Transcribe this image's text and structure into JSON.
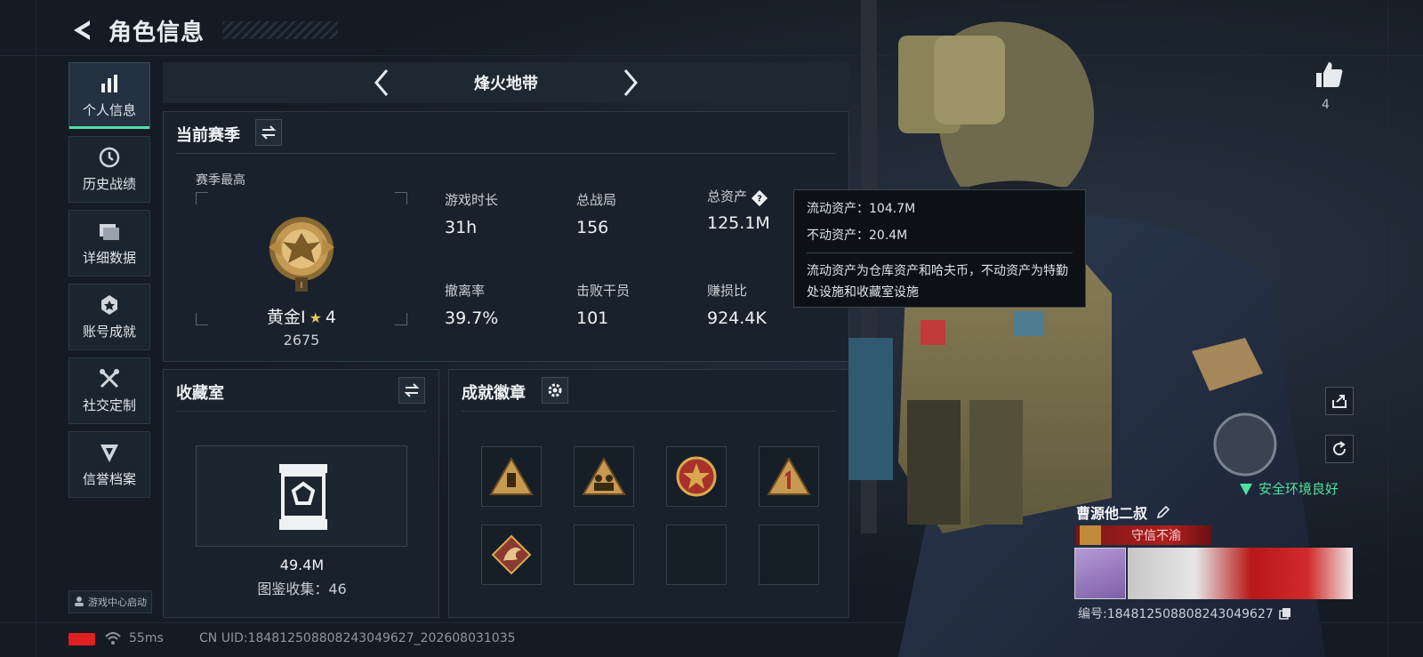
{
  "header": {
    "title": "角色信息"
  },
  "sidebar": {
    "items": [
      {
        "label": "个人信息",
        "icon": "bar-chart-icon",
        "active": true
      },
      {
        "label": "历史战绩",
        "icon": "clock-icon",
        "active": false
      },
      {
        "label": "详细数据",
        "icon": "folder-icon",
        "active": false
      },
      {
        "label": "账号成就",
        "icon": "medal-icon",
        "active": false
      },
      {
        "label": "社交定制",
        "icon": "tools-icon",
        "active": false
      },
      {
        "label": "信誉档案",
        "icon": "shield-icon",
        "active": false
      }
    ],
    "launch_label": "游戏中心启动"
  },
  "mode": {
    "name": "烽火地带"
  },
  "season": {
    "title": "当前赛季",
    "subtitle": "赛季最高",
    "rank_name": "黄金I",
    "rank_stars": "4",
    "rank_score": "2675",
    "stats": [
      {
        "label": "游戏时长",
        "value": "31h"
      },
      {
        "label": "总战局",
        "value": "156"
      },
      {
        "label": "总资产",
        "value": "125.1M"
      },
      {
        "label": "撤离率",
        "value": "39.7%"
      },
      {
        "label": "击败干员",
        "value": "101"
      },
      {
        "label": "赚损比",
        "value": "924.4K"
      }
    ]
  },
  "tooltip": {
    "liquid": "流动资产：104.7M",
    "fixed": "不动资产：20.4M",
    "desc": "流动资产为仓库资产和哈夫币，不动资产为特勤处设施和收藏室设施"
  },
  "collection": {
    "title": "收藏室",
    "value": "49.4M",
    "count_label": "图鉴收集：46"
  },
  "badges": {
    "title": "成就徽章",
    "filled": 5,
    "total": 8
  },
  "status": {
    "ping": "55ms",
    "uid": "CN UID:18481250880824304962​7_202608031035"
  },
  "character": {
    "likes": "4",
    "safe_text": "安全环境良好",
    "player_name": "曹源他二叔",
    "player_title": "守信不渝",
    "player_id": "编号:184812508808243049627"
  },
  "colors": {
    "accent": "#4fe0a8",
    "tooltip_bg": "#0d1115",
    "title_red": "#b02020"
  }
}
